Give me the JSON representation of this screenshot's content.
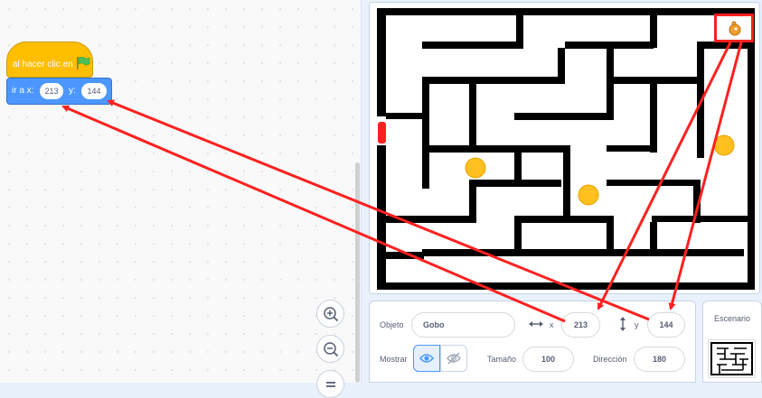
{
  "code": {
    "hat_block": {
      "label": "al hacer clic en",
      "flag_color": "#4cbf56"
    },
    "goto_block": {
      "label": "ir a x:",
      "x_value": "213",
      "y_label": "y:",
      "y_value": "144"
    },
    "zoom_in_icon": "zoom-in-icon",
    "zoom_out_icon": "zoom-out-icon",
    "reset_icon": "equal-icon"
  },
  "sprite_info": {
    "object_label": "Objeto",
    "object_name": "Gobo",
    "x_label": "x",
    "x_value": "213",
    "y_label": "y",
    "y_value": "144",
    "show_label": "Mostrar",
    "size_label": "Tamaño",
    "size_value": "100",
    "direction_label": "Dirección",
    "direction_value": "180"
  },
  "stage_panel": {
    "title": "Escenario"
  },
  "colors": {
    "accent_blue": "#4c97ff",
    "event_yellow": "#ffbf00",
    "annotation_red": "#ff2020"
  }
}
